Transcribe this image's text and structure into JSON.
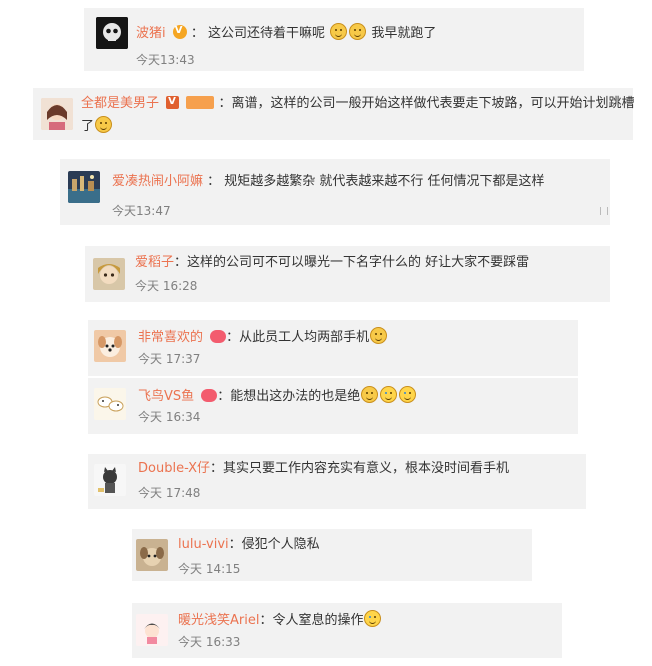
{
  "comments": [
    {
      "name": "波猪i",
      "text": "：  这公司还待着干嘛呢",
      "tail": "我早就跑了",
      "time": "今天13:43"
    },
    {
      "name": "全都是美男子",
      "text": "：离谱，这样的公司一般开始这样做代表要走下坡路，可以开始计划跳槽",
      "line2": "了",
      "time": ""
    },
    {
      "name": "爱凑热闹小阿嫲",
      "text": "： 规矩越多越繁杂 就代表越来越不行 任何情况下都是这样",
      "time": "今天13:47"
    },
    {
      "name": "爱稻子",
      "text": "：这样的公司可不可以曝光一下名字什么的 好让大家不要踩雷",
      "time": "今天 16:28"
    },
    {
      "name": "非常喜欢的",
      "text": "：从此员工人均两部手机",
      "time": "今天 17:37"
    },
    {
      "name": "飞鸟VS鱼",
      "text": "：能想出这办法的也是绝",
      "time": "今天 16:34"
    },
    {
      "name": "Double-X仔",
      "text": "：其实只要工作内容充实有意义，根本没时间看手机",
      "time": "今天 17:48"
    },
    {
      "name": "lulu-vivi",
      "text": "：侵犯个人隐私",
      "time": "今天 14:15"
    },
    {
      "name": "暖光浅笑Ariel",
      "text": "：令人窒息的操作",
      "time": "今天 16:33"
    }
  ],
  "icons": {
    "emoji_smile": "doge-emoji-icon",
    "emoji_cry": "laugh-cry-emoji-icon",
    "vip": "vip-badge-icon",
    "verified": "verified-badge-icon"
  },
  "colors": {
    "name": "#eb7350",
    "text": "#333333",
    "time": "#808080",
    "card": "#f2f2f2"
  }
}
